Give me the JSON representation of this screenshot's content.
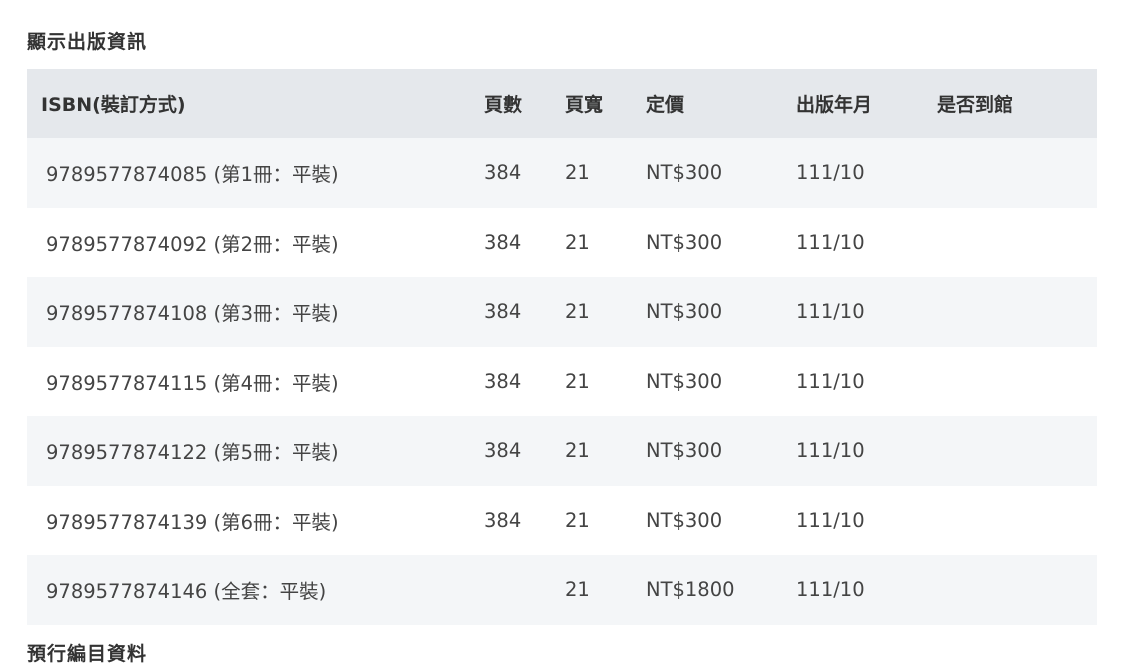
{
  "section_title": "顯示出版資訊",
  "next_section_title": "預行編目資料",
  "table": {
    "headers": {
      "isbn": "ISBN(裝訂方式)",
      "pages": "頁數",
      "width": "頁寬",
      "price": "定價",
      "pub_date": "出版年月",
      "in_library": "是否到館"
    },
    "rows": [
      {
        "isbn": "9789577874085 (第1冊：平裝)",
        "pages": "384",
        "width": "21",
        "price": "NT$300",
        "pub_date": "111/10",
        "in_library": ""
      },
      {
        "isbn": "9789577874092 (第2冊：平裝)",
        "pages": "384",
        "width": "21",
        "price": "NT$300",
        "pub_date": "111/10",
        "in_library": ""
      },
      {
        "isbn": "9789577874108 (第3冊：平裝)",
        "pages": "384",
        "width": "21",
        "price": "NT$300",
        "pub_date": "111/10",
        "in_library": ""
      },
      {
        "isbn": "9789577874115 (第4冊：平裝)",
        "pages": "384",
        "width": "21",
        "price": "NT$300",
        "pub_date": "111/10",
        "in_library": ""
      },
      {
        "isbn": "9789577874122 (第5冊：平裝)",
        "pages": "384",
        "width": "21",
        "price": "NT$300",
        "pub_date": "111/10",
        "in_library": ""
      },
      {
        "isbn": "9789577874139 (第6冊：平裝)",
        "pages": "384",
        "width": "21",
        "price": "NT$300",
        "pub_date": "111/10",
        "in_library": ""
      },
      {
        "isbn": "9789577874146 (全套：平裝)",
        "pages": "",
        "width": "21",
        "price": "NT$1800",
        "pub_date": "111/10",
        "in_library": ""
      }
    ]
  },
  "colors": {
    "header_bg": "#e5e8ec",
    "row_alt_bg": "#f4f6f8",
    "text": "#333333"
  }
}
